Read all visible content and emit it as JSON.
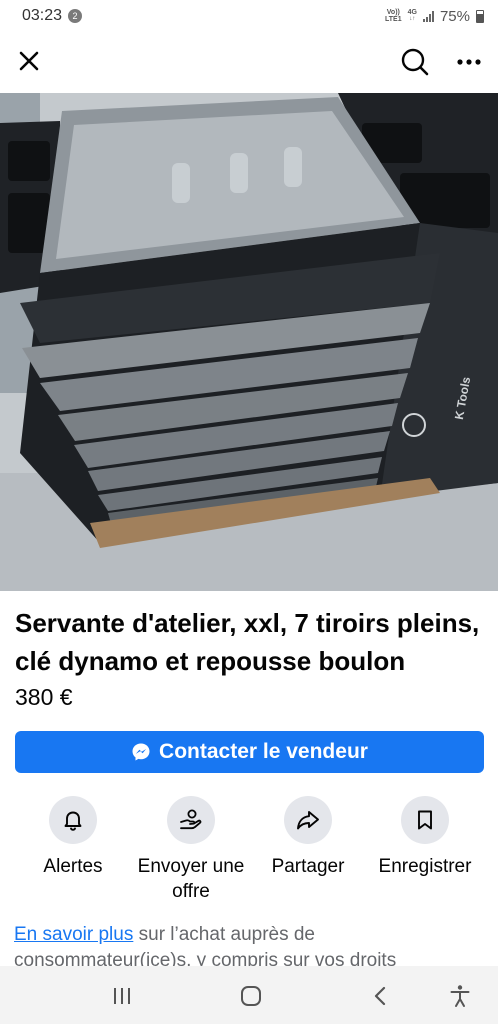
{
  "status_bar": {
    "time": "03:23",
    "notification_count": "2",
    "network_top": "Vo))",
    "network_bottom": "LTE1",
    "network_type": "4G",
    "battery": "75%"
  },
  "header": {
    "close_icon": "close-icon",
    "search_icon": "search-icon",
    "more_icon": "more-options-icon"
  },
  "gallery": {
    "dot_count": 9,
    "active_index": 0,
    "brand_text": "K Tools"
  },
  "listing": {
    "title": "Servante d'atelier, xxl, 7 tiroirs pleins, clé dynamo et repousse boulon",
    "price": "380 €"
  },
  "contact_button": {
    "label": "Contacter le vendeur",
    "icon": "messenger-icon"
  },
  "actions": [
    {
      "label": "Alertes",
      "icon": "bell-icon"
    },
    {
      "label": "Envoyer une offre",
      "icon": "offer-hand-icon"
    },
    {
      "label": "Partager",
      "icon": "share-arrow-icon"
    },
    {
      "label": "Enregistrer",
      "icon": "bookmark-icon"
    }
  ],
  "info": {
    "link_text": "En savoir plus",
    "text": " sur l’achat auprès de consommateur(ice)s, y compris sur vos droits"
  },
  "nav_bar": {
    "recents_icon": "recent-apps-icon",
    "home_icon": "home-icon",
    "back_icon": "back-icon",
    "accessibility_icon": "accessibility-icon"
  },
  "colors": {
    "accent": "#1877f2",
    "action_bg": "#e4e6eb",
    "muted_text": "#65676b"
  }
}
